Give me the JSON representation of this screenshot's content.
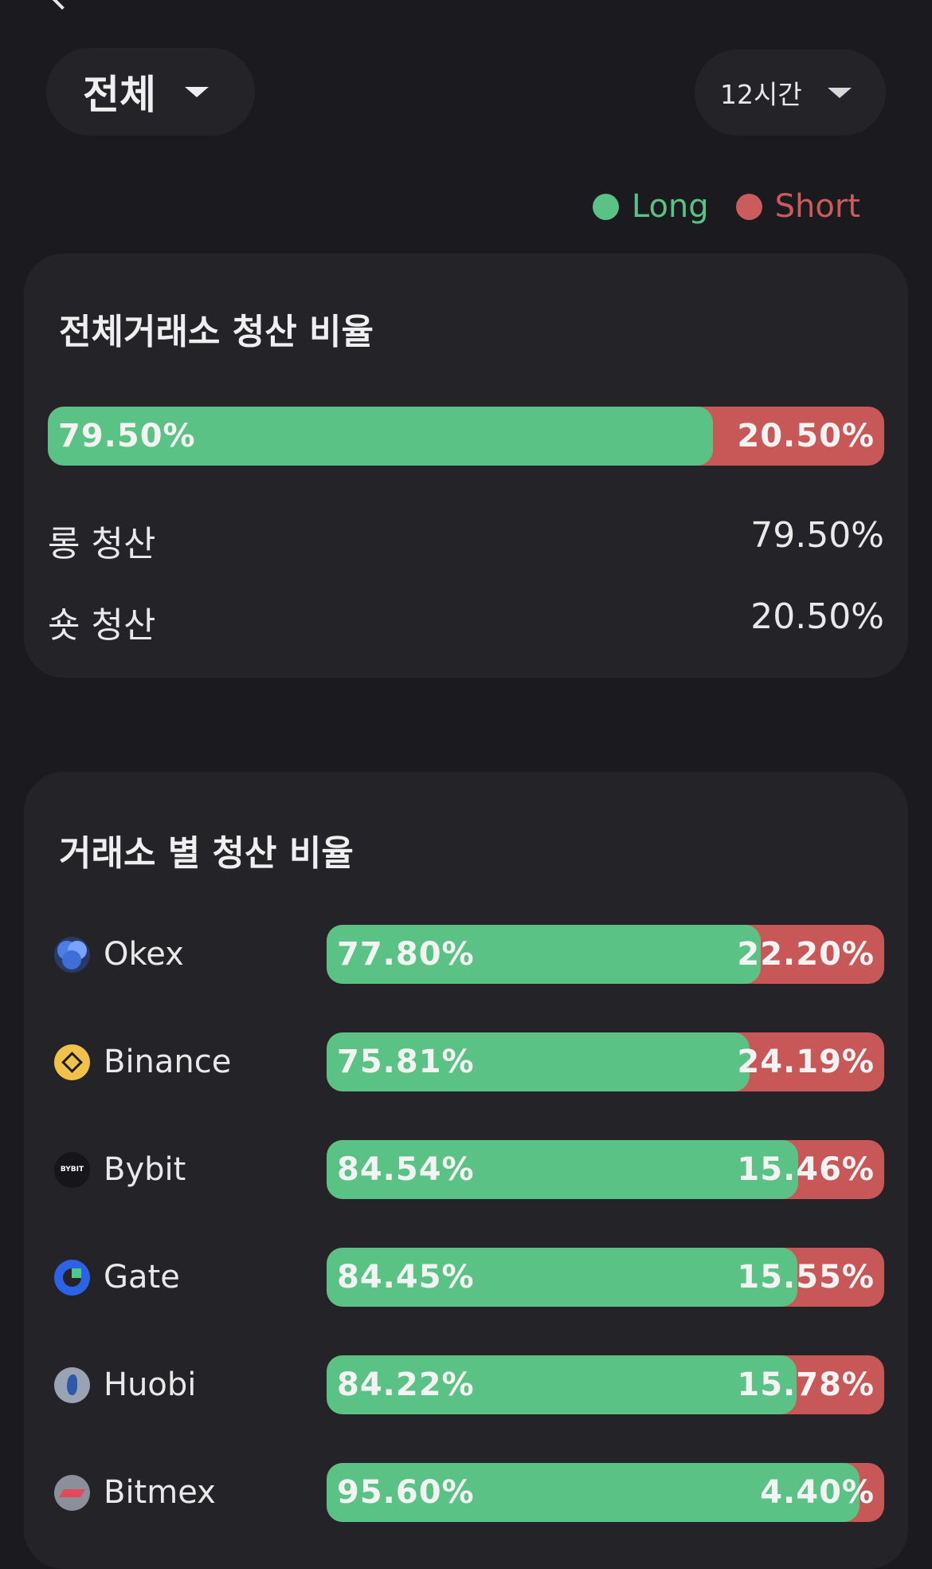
{
  "header": {
    "exchange_select": "전체",
    "period_select": "12시간"
  },
  "legend": {
    "long": "Long",
    "short": "Short",
    "long_color": "#5bc286",
    "short_color": "#cb5c5c"
  },
  "overall": {
    "title": "전체거래소 청산 비율",
    "long_pct": "79.50%",
    "short_pct": "20.50%",
    "long_fraction": 0.795,
    "long_label": "롱 청산",
    "long_value": "79.50%",
    "short_label": "숏 청산",
    "short_value": "20.50%"
  },
  "by_exchange": {
    "title": "거래소 별 청산 비율",
    "rows": [
      {
        "name": "Okex",
        "icon": "okex-icon",
        "long": "77.80%",
        "short": "22.20%",
        "long_fraction": 0.778
      },
      {
        "name": "Binance",
        "icon": "binance-icon",
        "long": "75.81%",
        "short": "24.19%",
        "long_fraction": 0.7581
      },
      {
        "name": "Bybit",
        "icon": "bybit-icon",
        "icon_text": "BYBIT",
        "long": "84.54%",
        "short": "15.46%",
        "long_fraction": 0.8454
      },
      {
        "name": "Gate",
        "icon": "gate-icon",
        "long": "84.45%",
        "short": "15.55%",
        "long_fraction": 0.8445
      },
      {
        "name": "Huobi",
        "icon": "huobi-icon",
        "long": "84.22%",
        "short": "15.78%",
        "long_fraction": 0.8422
      },
      {
        "name": "Bitmex",
        "icon": "bitmex-icon",
        "long": "95.60%",
        "short": "4.40%",
        "long_fraction": 0.956
      }
    ]
  }
}
